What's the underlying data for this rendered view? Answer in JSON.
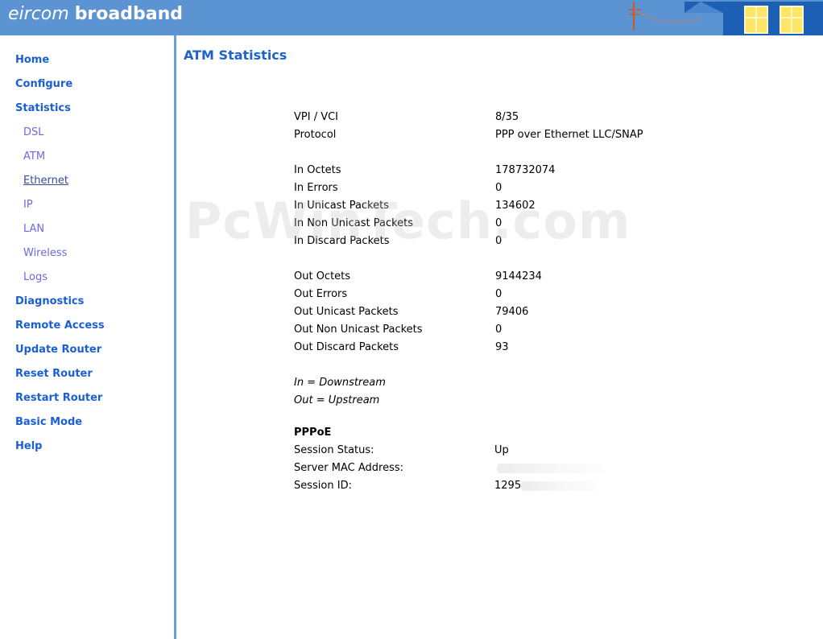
{
  "header": {
    "brand_light": "eircom",
    "brand_bold": "broadband"
  },
  "sidebar": {
    "items": [
      {
        "label": "Home",
        "level": "main"
      },
      {
        "label": "Configure",
        "level": "main"
      },
      {
        "label": "Statistics",
        "level": "main"
      },
      {
        "label": "DSL",
        "level": "sub"
      },
      {
        "label": "ATM",
        "level": "sub"
      },
      {
        "label": "Ethernet",
        "level": "sub",
        "active": true
      },
      {
        "label": "IP",
        "level": "sub"
      },
      {
        "label": "LAN",
        "level": "sub"
      },
      {
        "label": "Wireless",
        "level": "sub"
      },
      {
        "label": "Logs",
        "level": "sub"
      },
      {
        "label": "Diagnostics",
        "level": "main"
      },
      {
        "label": "Remote Access",
        "level": "main"
      },
      {
        "label": "Update Router",
        "level": "main"
      },
      {
        "label": "Reset Router",
        "level": "main"
      },
      {
        "label": "Restart Router",
        "level": "main"
      },
      {
        "label": "Basic Mode",
        "level": "main"
      },
      {
        "label": "Help",
        "level": "main"
      }
    ]
  },
  "main": {
    "title": "ATM Statistics",
    "stats": [
      {
        "label": "VPI / VCI",
        "value": "8/35"
      },
      {
        "label": "Protocol",
        "value": "PPP over Ethernet LLC/SNAP"
      },
      {
        "label": "In Octets",
        "value": "178732074"
      },
      {
        "label": "In Errors",
        "value": "0"
      },
      {
        "label": "In Unicast Packets",
        "value": "134602"
      },
      {
        "label": "In Non Unicast Packets",
        "value": "0"
      },
      {
        "label": "In Discard Packets",
        "value": "0"
      },
      {
        "label": "Out Octets",
        "value": "9144234"
      },
      {
        "label": "Out Errors",
        "value": "0"
      },
      {
        "label": "Out Unicast Packets",
        "value": "79406"
      },
      {
        "label": "Out Non Unicast Packets",
        "value": "0"
      },
      {
        "label": "Out Discard Packets",
        "value": "93"
      }
    ],
    "notes": [
      "In = Downstream",
      "Out = Upstream"
    ],
    "pppoe": {
      "heading": "PPPoE",
      "session_status_label": "Session Status:",
      "session_status_value": "Up",
      "server_mac_label": "Server MAC Address:",
      "session_id_label": "Session ID:",
      "session_id_value": "1295"
    }
  },
  "watermark": "PcWinTech.com",
  "colors": {
    "header_bg": "#5b93d3",
    "nav_main": "#1a5fd4",
    "nav_sub": "#6a6ae0",
    "title": "#1d63c9"
  }
}
